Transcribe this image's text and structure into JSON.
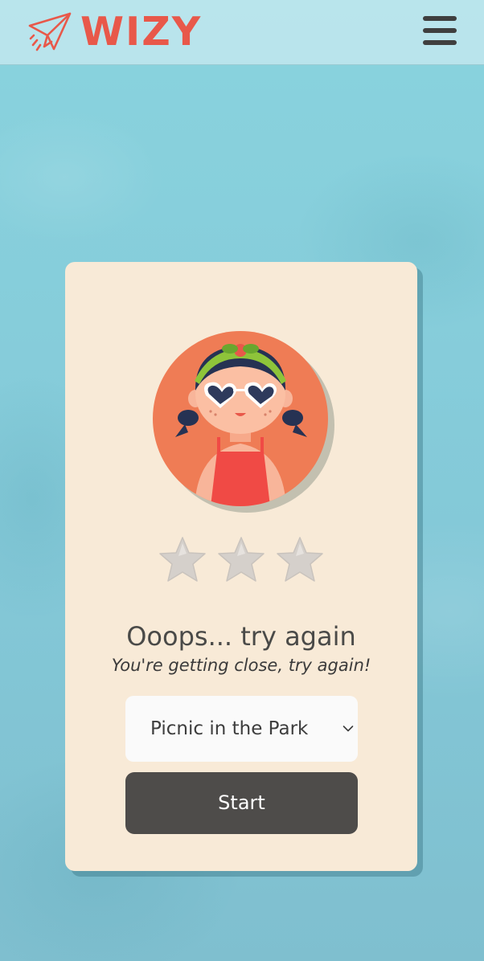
{
  "header": {
    "brand": "WIZY",
    "brand_color": "#e8584a",
    "logo_icon": "paper-plane-icon",
    "menu_icon": "hamburger-menu-icon"
  },
  "result": {
    "avatar": "girl-with-heart-sunglasses-avatar",
    "stars_earned": 0,
    "stars_total": 3,
    "title": "Ooops... try again",
    "message": "You're getting close, try again!"
  },
  "level_select": {
    "selected": "Picnic in the Park"
  },
  "start_button": {
    "label": "Start"
  }
}
